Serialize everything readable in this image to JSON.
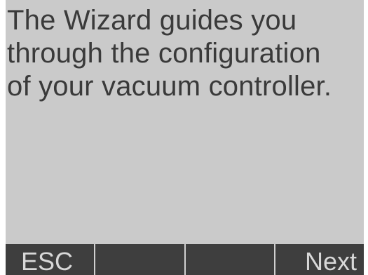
{
  "message": {
    "lines": [
      "The Wizard guides you",
      "through the configuration",
      "of your vacuum controller."
    ]
  },
  "softkeys": {
    "esc_label": "ESC",
    "key2_label": "",
    "key3_label": "",
    "next_label": "Next"
  },
  "colors": {
    "lcd_background": "#cacaca",
    "text": "#3a3a3a",
    "softkey_bar": "#3e3e3e",
    "softkey_text": "#d8d8d8"
  }
}
